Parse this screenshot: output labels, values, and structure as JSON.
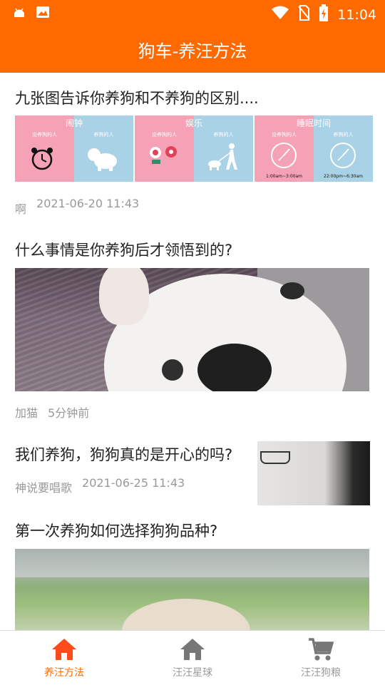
{
  "status_bar": {
    "time": "11:04"
  },
  "header": {
    "title": "狗车-养汪方法"
  },
  "articles": [
    {
      "title": "九张图告诉你养狗和不养狗的区别....",
      "author": "啊",
      "time": "2021-06-20 11:43",
      "panels": [
        {
          "title": "闹钟",
          "left_label": "没养狗的人",
          "right_label": "养狗的人"
        },
        {
          "title": "娱乐",
          "left_label": "没养狗的人",
          "right_label": "养狗的人"
        },
        {
          "title": "睡眠时间",
          "left_label": "没养狗的人",
          "right_label": "养狗的人",
          "left_time": "1:00am~3:00am",
          "right_time": "22:00pm~6:30am"
        }
      ]
    },
    {
      "title": "什么事情是你养狗后才领悟到的?",
      "author": "加猫",
      "time": "5分钟前"
    },
    {
      "title": "我们养狗，狗狗真的是开心的吗?",
      "author": "神说要唱歌",
      "time": "2021-06-25 11:43"
    },
    {
      "title": "第一次养狗如何选择狗狗品种?"
    }
  ],
  "tabs": [
    {
      "label": "养汪方法",
      "icon": "home-icon",
      "active": true
    },
    {
      "label": "汪汪星球",
      "icon": "home-icon",
      "active": false
    },
    {
      "label": "汪汪狗粮",
      "icon": "cart-icon",
      "active": false
    }
  ],
  "colors": {
    "accent": "#ff6a00",
    "active_tab": "#ff6a00",
    "inactive_tab": "#9a9a9a",
    "panel_pink": "#f6a2b6",
    "panel_blue": "#a9d2e6"
  }
}
